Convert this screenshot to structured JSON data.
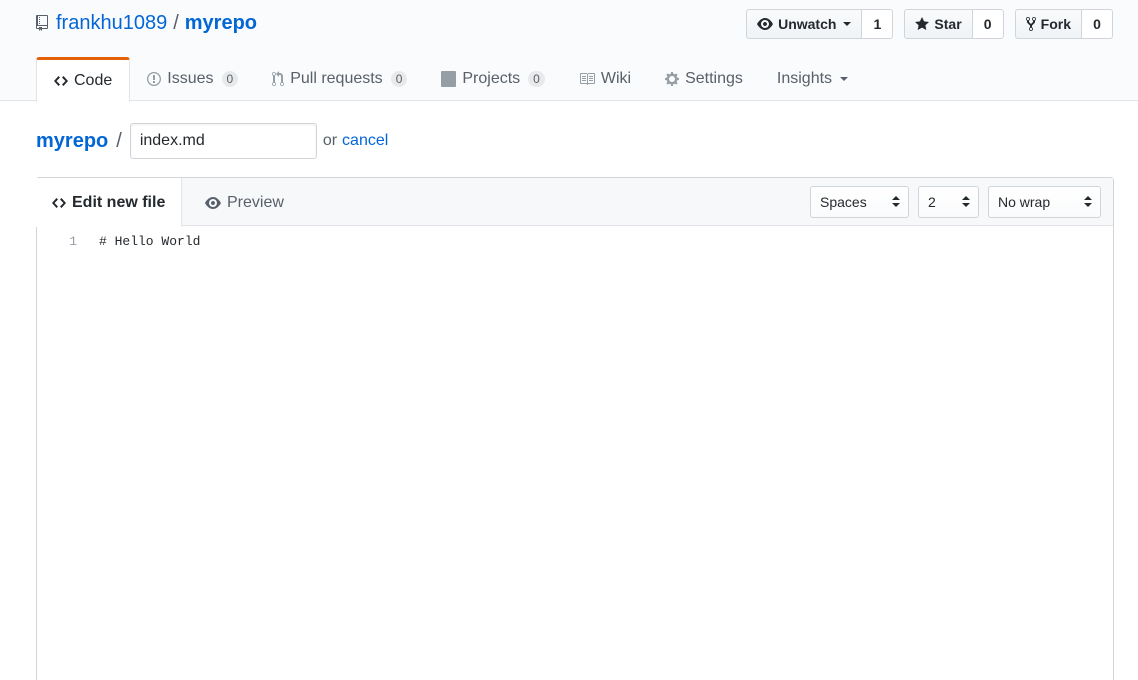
{
  "repo": {
    "owner": "frankhu1089",
    "separator": "/",
    "name": "myrepo"
  },
  "actions": {
    "watch": {
      "label": "Unwatch",
      "count": "1"
    },
    "star": {
      "label": "Star",
      "count": "0"
    },
    "fork": {
      "label": "Fork",
      "count": "0"
    }
  },
  "nav": {
    "code": "Code",
    "issues": {
      "label": "Issues",
      "count": "0"
    },
    "pulls": {
      "label": "Pull requests",
      "count": "0"
    },
    "projects": {
      "label": "Projects",
      "count": "0"
    },
    "wiki": "Wiki",
    "settings": "Settings",
    "insights": "Insights"
  },
  "breadcrumb": {
    "repo": "myrepo",
    "separator": "/",
    "filename": "index.md",
    "or": "or",
    "cancel": "cancel"
  },
  "editor": {
    "tab_edit": "Edit new file",
    "tab_preview": "Preview",
    "indent_mode": "Spaces",
    "indent_size": "2",
    "wrap_mode": "No wrap",
    "lines": [
      {
        "number": "1",
        "text": "# Hello World"
      }
    ]
  },
  "colors": {
    "link": "#0366d6",
    "selected_tab_accent": "#e36209"
  }
}
